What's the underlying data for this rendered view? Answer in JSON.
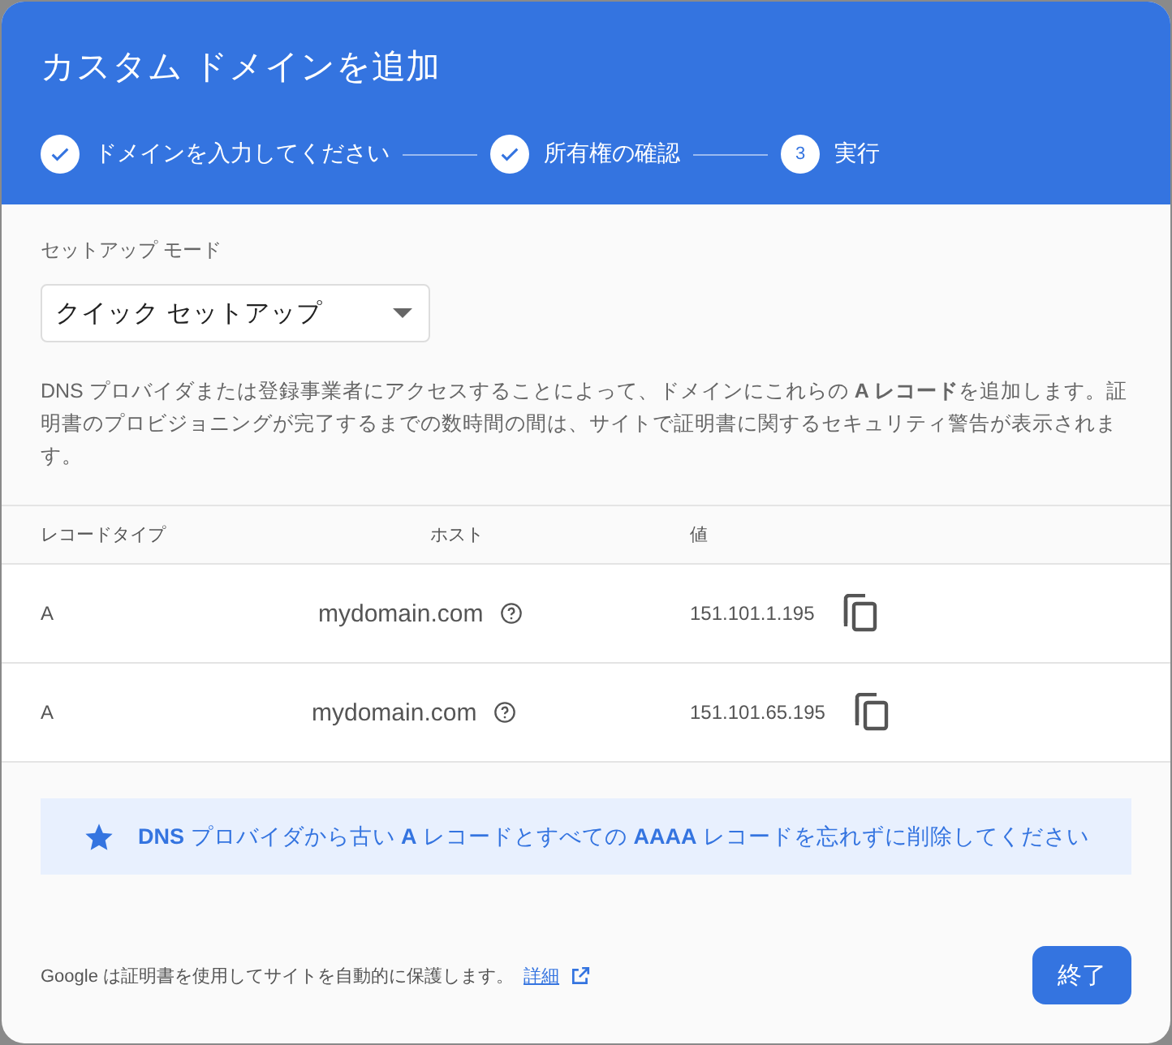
{
  "dialog": {
    "title": "カスタム ドメインを追加"
  },
  "steps": [
    {
      "label": "ドメインを入力してください",
      "completed": true
    },
    {
      "label": "所有権の確認",
      "completed": true
    },
    {
      "label": "実行",
      "completed": false,
      "number": "3"
    }
  ],
  "setup_mode": {
    "label": "セットアップ モード",
    "value": "クイック セットアップ"
  },
  "description": "DNS プロバイダまたは登録事業者にアクセスすることによって、ドメインにこれらの **A レコード**を追加します。証明書のプロビジョニングが完了するまでの数時間の間は、サイトで証明書に関するセキュリティ警告が表示されます。",
  "table": {
    "columns": [
      "レコードタイプ",
      "ホスト",
      "値"
    ],
    "rows": [
      {
        "type": "A",
        "host": "mydomain.com",
        "value": "151.101.1.195"
      },
      {
        "type": "A",
        "host": "mydomain.com",
        "value": "151.101.65.195"
      }
    ]
  },
  "notice": "**DNS** プロバイダから古い **A** レコードとすべての **AAAA** レコードを忘れずに削除してください",
  "footer": {
    "text": "Google は証明書を使用してサイトを自動的に保護します。",
    "link": "詳細",
    "button": "終了"
  }
}
